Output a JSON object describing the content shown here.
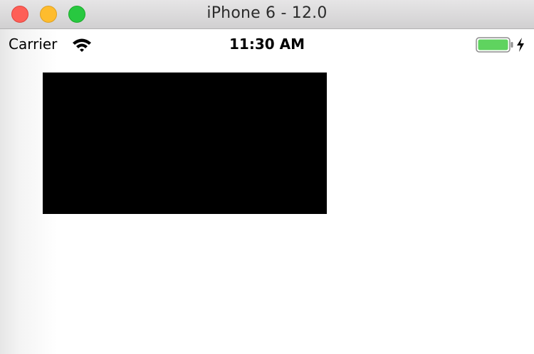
{
  "window": {
    "title": "iPhone 6 - 12.0",
    "controls": {
      "close_color": "#fe5f57",
      "minimize_color": "#febc2e",
      "zoom_color": "#28c840"
    }
  },
  "statusbar": {
    "carrier": "Carrier",
    "time": "11:30 AM",
    "wifi_icon": "wifi-icon",
    "battery_icon": "battery-icon",
    "battery_level": 1.0,
    "battery_color": "#5fd35f",
    "charging_icon": "charging-bolt-icon"
  },
  "content": {
    "view_color": "#000000"
  }
}
